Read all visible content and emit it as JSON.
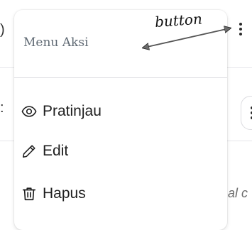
{
  "menu": {
    "header": "Menu Aksi",
    "items": [
      {
        "label": "Pratinjau",
        "icon": "eye-icon"
      },
      {
        "label": "Edit",
        "icon": "pencil-icon"
      },
      {
        "label": "Hapus",
        "icon": "trash-icon"
      }
    ]
  },
  "annotation": {
    "label": "button"
  },
  "background": {
    "partial_text": "al c"
  },
  "colors": {
    "header_text": "#5f6973",
    "item_text": "#1e1e1e",
    "divider": "#dedfe3",
    "row_line": "#e6e6ea"
  }
}
